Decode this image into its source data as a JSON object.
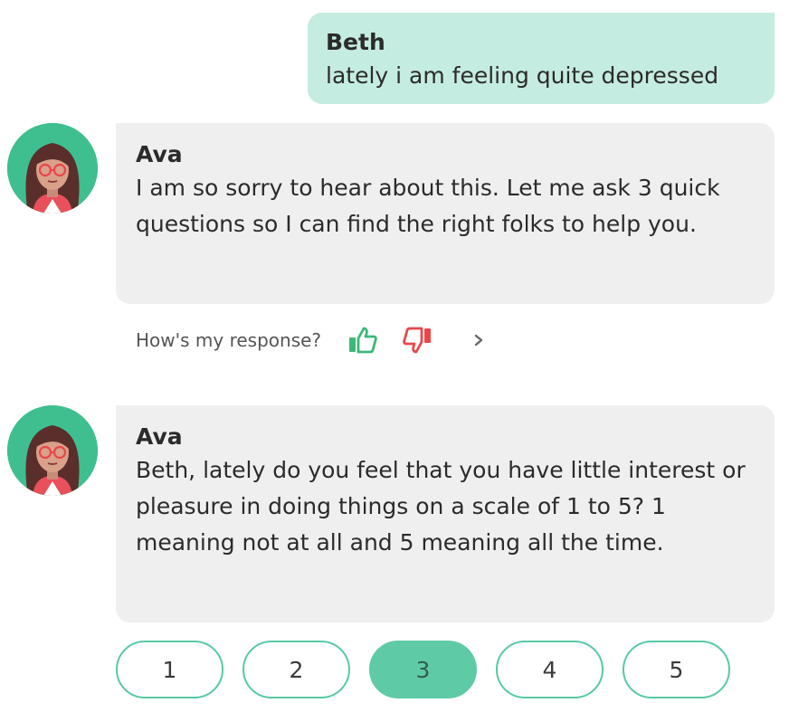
{
  "user_message": {
    "sender": "Beth",
    "text": "lately i am feeling quite depressed"
  },
  "bot_messages": [
    {
      "sender": "Ava",
      "text": "I am so sorry to hear about this. Let me ask 3 quick questions so I can find the right folks to help you."
    },
    {
      "sender": "Ava",
      "text": "Beth, lately do you feel that you have little interest or pleasure in doing things on a scale of 1 to 5? 1 meaning not at all and 5 meaning all the time."
    }
  ],
  "feedback": {
    "label": "How's my response?",
    "icons": [
      "thumbs-up-icon",
      "thumbs-down-icon",
      "chevron-right-icon"
    ]
  },
  "scale": {
    "options": [
      "1",
      "2",
      "3",
      "4",
      "5"
    ],
    "selected": "3"
  },
  "colors": {
    "user_bubble": "#c5ece0",
    "bot_bubble": "#efefef",
    "accent": "#5fcaa6",
    "thumb_up": "#3cb878",
    "thumb_down": "#e8474a"
  }
}
